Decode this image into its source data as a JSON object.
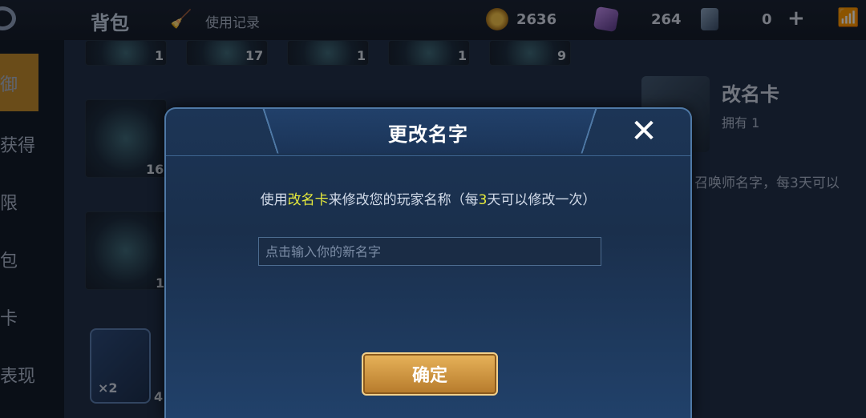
{
  "topbar": {
    "title": "背包",
    "history_label": "使用记录",
    "history_icon": "broom-icon",
    "gold": "2636",
    "gems": "264",
    "cards": "0",
    "plus_symbol": "+",
    "wifi_icon": "wifi-icon"
  },
  "sidebar": {
    "items": [
      "御",
      "获得",
      "限",
      "包",
      "卡",
      "表现"
    ]
  },
  "grid": {
    "row1_counts": [
      "1",
      "17",
      "1",
      "1",
      "9"
    ],
    "tile_counts": [
      "16",
      "1",
      "4"
    ],
    "card_badge": "×2"
  },
  "detail": {
    "name": "改名卡",
    "owned": "拥有 1",
    "description": "召唤师名字，每3天可以"
  },
  "dialog": {
    "title": "更改名字",
    "close_symbol": "✕",
    "desc_pre": "使用",
    "desc_item": "改名卡",
    "desc_mid": "来修改您的玩家名称（每",
    "desc_days": "3",
    "desc_post": "天可以修改一次）",
    "input_placeholder": "点击输入你的新名字",
    "input_value": "",
    "confirm_label": "确定"
  },
  "colors": {
    "highlight": "#e6ea3c",
    "dialog_bg": "#1c3556",
    "button_gold": "#e7b35a",
    "wifi": "#3fd66d"
  }
}
